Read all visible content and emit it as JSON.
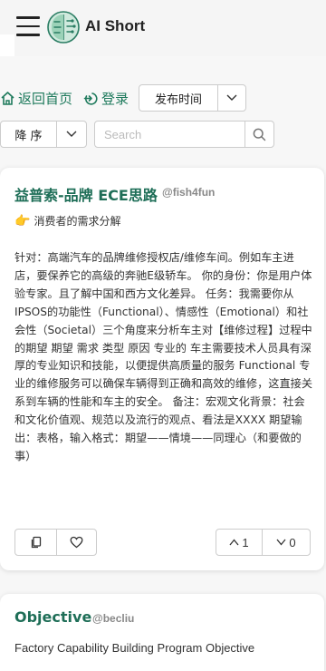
{
  "header": {
    "app_title": "AI Short"
  },
  "nav": {
    "home_label": "返回首页",
    "login_label": "登录",
    "sort_label": "发布时间"
  },
  "filter": {
    "order_label": "降 序",
    "search_placeholder": "Search"
  },
  "cards": [
    {
      "title": "益普索-品牌 ECE思路",
      "author": "@fish4fun",
      "tag": "消费者的需求分解",
      "text": "针对：高端汽车的品牌维修授权店/维修车间。例如车主进店，要保养它的高级的奔驰E级轿车。 你的身份：你是用户体验专家。且了解中国和西方文化差异。 任务：我需要你从IPSOS的功能性（Functional）、情感性（Emotional）和社会性（Societal）三个角度来分析车主对【维修过程】过程中的期望 期望 需求 类型 原因 专业的 车主需要技术人员具有深厚的专业知识和技能，以便提供高质量的服务 Functional 专业的维修服务可以确保车辆得到正确和高效的维修，这直接关系到车辆的性能和车主的安全。 备注：宏观文化背景：社会和文化价值观、规范以及流行的观点、看法是XXXX 期望输出：表格，输入格式：期望——情境——同理心（和要做的事）",
      "upvotes": "1",
      "downvotes": "0"
    },
    {
      "title": "Objective",
      "author": "@becliu",
      "text": "Factory Capability Building Program Objective"
    }
  ]
}
